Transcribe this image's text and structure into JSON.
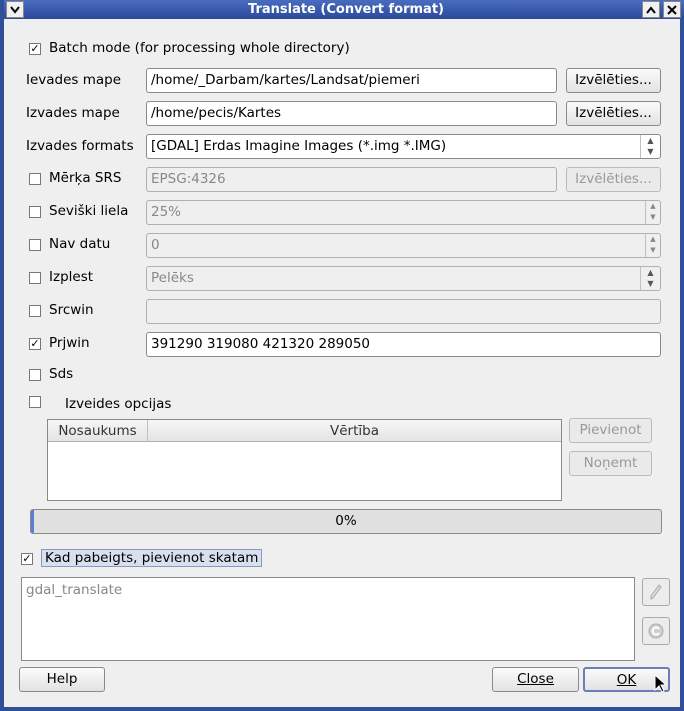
{
  "window": {
    "title": "Translate (Convert format)"
  },
  "batch": {
    "label": "Batch mode (for processing whole directory)",
    "checked": true
  },
  "input_dir": {
    "label": "Ievades mape",
    "value": "/home/_Darbam/kartes/Landsat/piemeri",
    "browse": "Izvēlēties..."
  },
  "output_dir": {
    "label": "Izvades mape",
    "value": "/home/pecis/Kartes",
    "browse": "Izvēlēties..."
  },
  "output_format": {
    "label": "Izvades formats",
    "value": "[GDAL] Erdas Imagine Images  (*.img *.IMG)"
  },
  "target_srs": {
    "label": "Mērķa SRS",
    "value": "EPSG:4326",
    "browse": "Izvēlēties...",
    "checked": false
  },
  "outsize": {
    "label": "Seviški liela",
    "value": "25%",
    "checked": false
  },
  "nodata": {
    "label": "Nav datu",
    "value": "0",
    "checked": false
  },
  "expand": {
    "label": "Izplest",
    "value": "Pelēks",
    "checked": false
  },
  "srcwin": {
    "label": "Srcwin",
    "value": "",
    "checked": false
  },
  "prjwin": {
    "label": "Prjwin",
    "value": "391290 319080 421320 289050",
    "checked": true
  },
  "sds": {
    "label": "Sds",
    "checked": false
  },
  "creation_options": {
    "label": "Izveides opcijas",
    "checked": false,
    "col_name": "Nosaukums",
    "col_value": "Vērtība",
    "add": "Pievienot",
    "remove": "Noņemt"
  },
  "progress": {
    "text": "0%",
    "value": 0
  },
  "load_when_done": {
    "label": "Kad pabeigts, pievienot skatam",
    "checked": true
  },
  "command": {
    "text": "gdal_translate"
  },
  "buttons": {
    "help": "Help",
    "close": "Close",
    "ok": "OK"
  },
  "icons": [
    "chevron-down-icon",
    "chevron-up-icon",
    "close-icon",
    "edit-pencil-icon",
    "reset-icon",
    "mouse-cursor-icon"
  ]
}
